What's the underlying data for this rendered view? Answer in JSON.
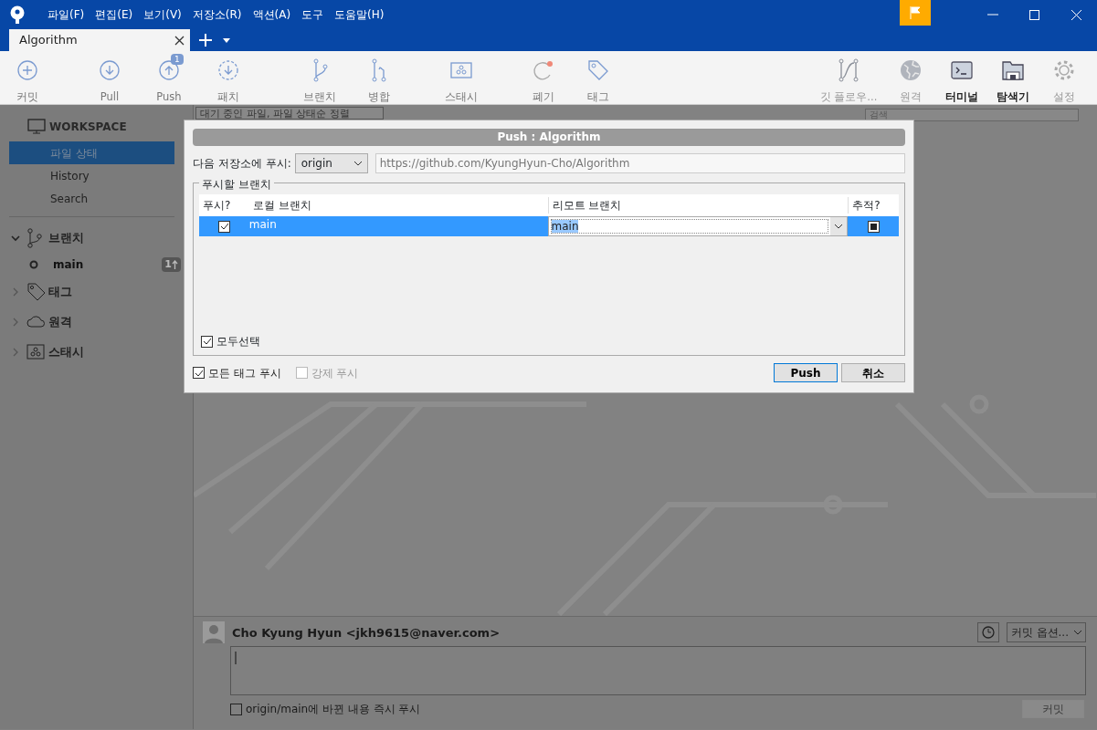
{
  "menu": [
    {
      "label": "파일(F)"
    },
    {
      "label": "편집(E)"
    },
    {
      "label": "보기(V)"
    },
    {
      "label": "저장소(R)"
    },
    {
      "label": "액션(A)"
    },
    {
      "label": "도구"
    },
    {
      "label": "도움말(H)"
    }
  ],
  "tab": {
    "title": "Algorithm"
  },
  "toolbar_left": [
    {
      "label": "커밋"
    },
    {
      "label": "Pull"
    },
    {
      "label": "Push",
      "badge": "1"
    },
    {
      "label": "패치"
    },
    {
      "label": "브랜치"
    },
    {
      "label": "병합"
    },
    {
      "label": "스태시"
    },
    {
      "label": "폐기"
    },
    {
      "label": "태그"
    }
  ],
  "toolbar_right": [
    {
      "label": "깃 플로우...",
      "disabled": true
    },
    {
      "label": "원격",
      "disabled": true
    },
    {
      "label": "터미널",
      "disabled": false
    },
    {
      "label": "탐색기",
      "disabled": false
    },
    {
      "label": "설정",
      "disabled": true
    }
  ],
  "sidebar": {
    "workspace": "WORKSPACE",
    "items": [
      {
        "label": "파일 상태",
        "selected": true
      },
      {
        "label": "History",
        "selected": false
      },
      {
        "label": "Search",
        "selected": false
      }
    ],
    "sections": [
      {
        "label": "브랜치",
        "expanded": true,
        "children": [
          {
            "label": "main",
            "badge": "1"
          }
        ]
      },
      {
        "label": "태그",
        "expanded": false
      },
      {
        "label": "원격",
        "expanded": false
      },
      {
        "label": "스태시",
        "expanded": false
      }
    ]
  },
  "filter": {
    "label": "대기 중인 파일, 파일 상태순 정렬"
  },
  "search": {
    "placeholder": "검색"
  },
  "dialog": {
    "title": "Push :  Algorithm",
    "remote_label": "다음 저장소에 푸시:",
    "remote": "origin",
    "url": "https://github.com/KyungHyun-Cho/Algorithm",
    "group": "푸시할 브랜치",
    "columns": [
      "푸시?",
      "로컬 브랜치",
      "리모트 브랜치",
      "추적?"
    ],
    "rows": [
      {
        "push": true,
        "local": "main",
        "remote": "main",
        "track": true,
        "selected": true
      }
    ],
    "select_all": {
      "label": "모두선택",
      "checked": true
    },
    "options": [
      {
        "label": "모든 태그 푸시",
        "checked": true,
        "disabled": false
      },
      {
        "label": "강제 푸시",
        "checked": false,
        "disabled": true
      }
    ],
    "buttons": [
      {
        "label": "Push",
        "default": true
      },
      {
        "label": "취소",
        "default": false
      }
    ]
  },
  "commit": {
    "author": "Cho Kyung Hyun <jkh9615@naver.com>",
    "options": "커밋 옵션...",
    "push_now": {
      "label": "origin/main에 바뀐 내용 즉시 푸시",
      "checked": false
    },
    "button": "커밋"
  }
}
